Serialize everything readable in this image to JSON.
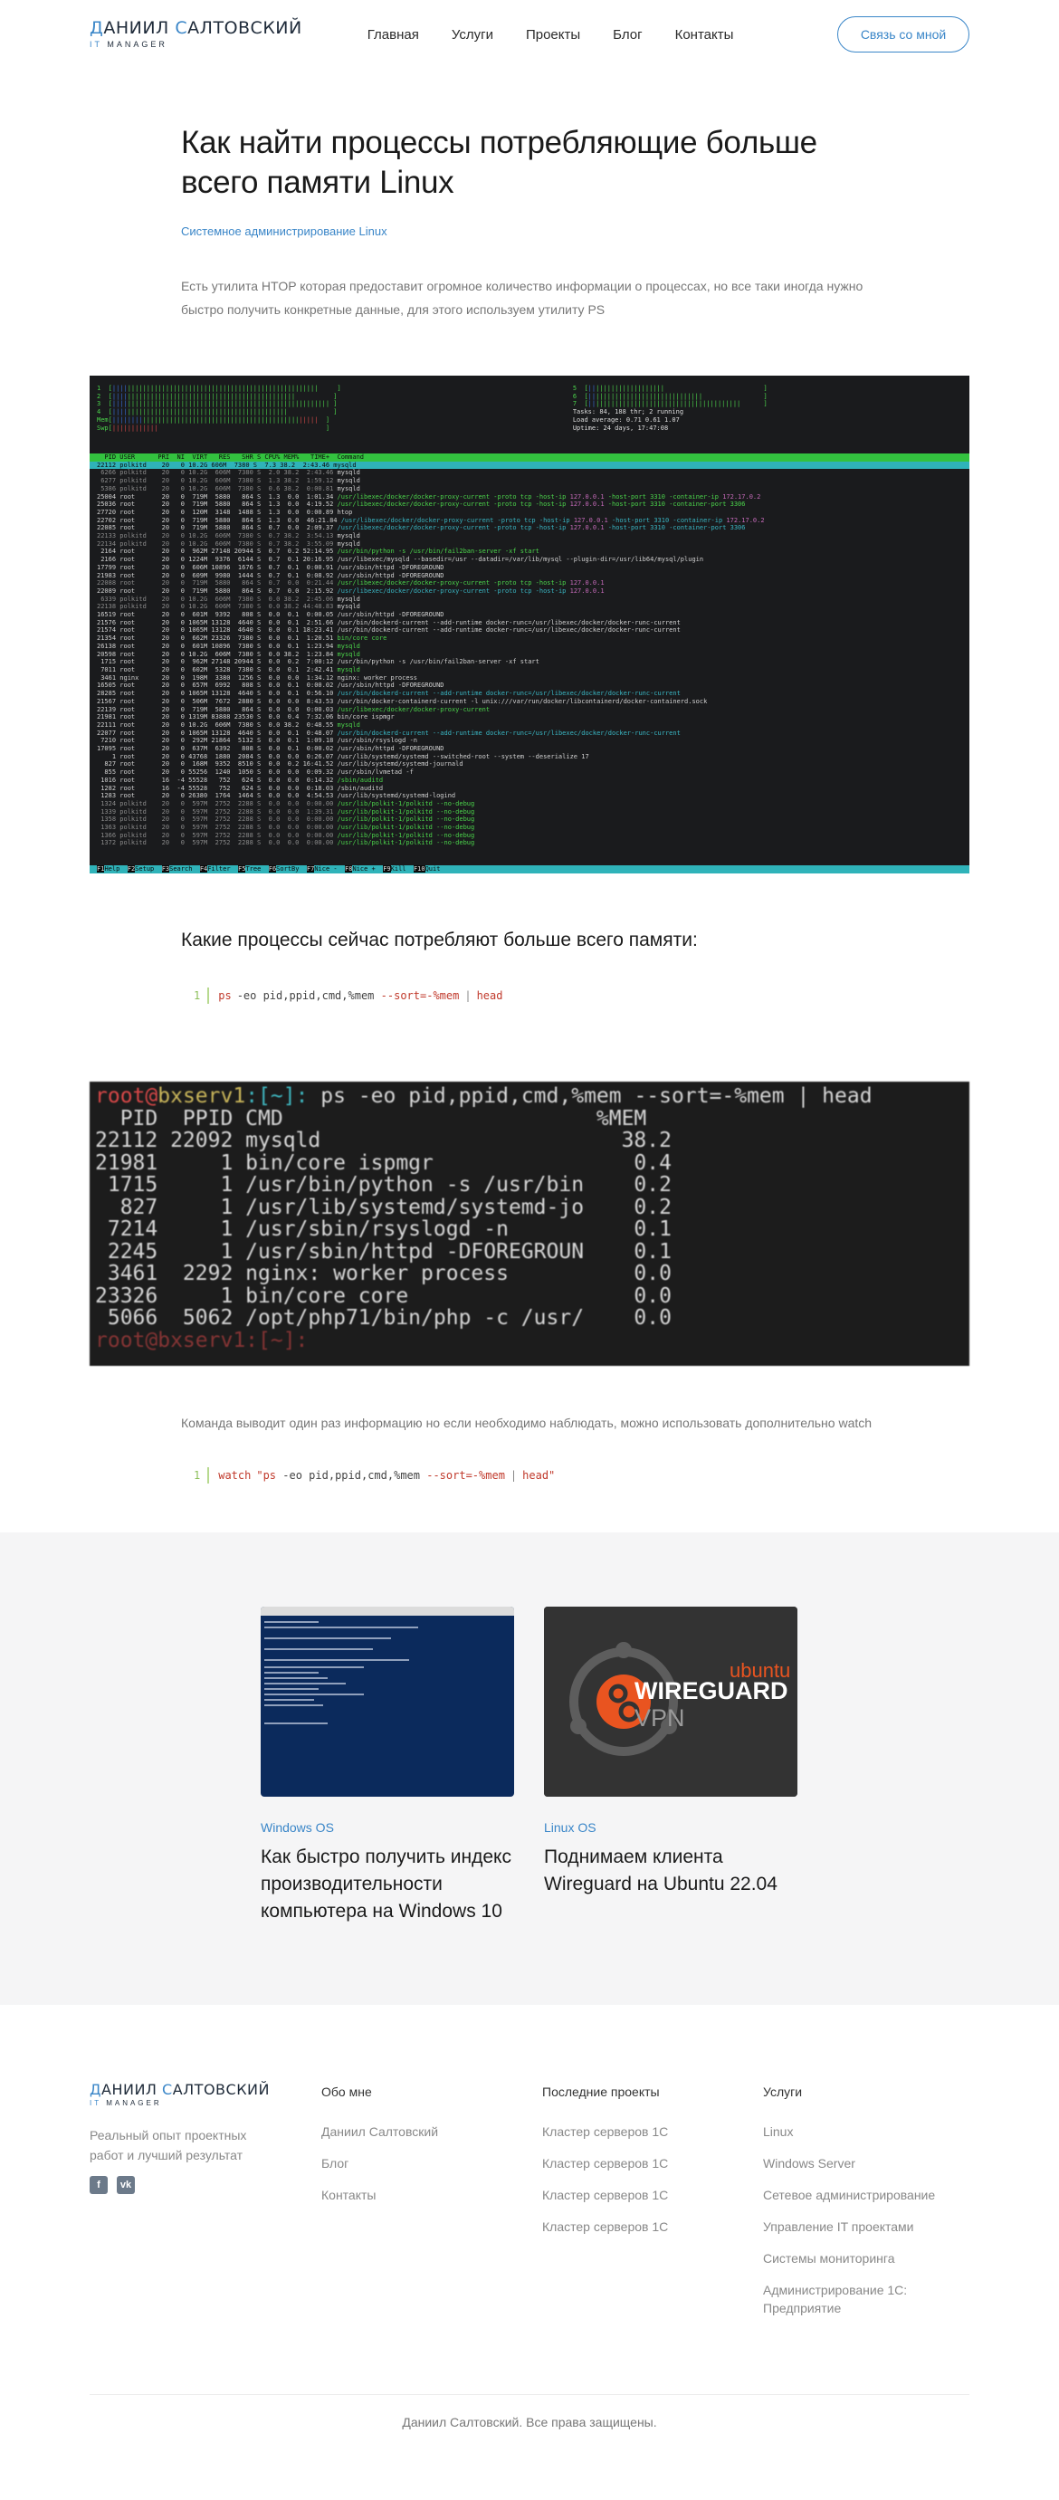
{
  "header": {
    "logo_first": "Д",
    "logo_first_rest": "АНИИЛ ",
    "logo_last": "С",
    "logo_last_rest": "АЛТОВСКИЙ",
    "logo_sub_it": "IT ",
    "logo_sub_manager": "MANAGER",
    "nav": [
      "Главная",
      "Услуги",
      "Проекты",
      "Блог",
      "Контакты"
    ],
    "contact_button": "Связь со мной"
  },
  "article": {
    "title": "Как найти процессы потребляющие больше всего памяти Linux",
    "category": "Системное администрирование Linux",
    "intro": "Есть утилита HTOP которая предоставит огромное количество информации о процессах, но все таки иногда нужно быстро получить конкретные данные, для этого используем утилиту PS",
    "section_heading": "Какие процессы сейчас потребляют больше всего памяти:",
    "code1": {
      "line": "1",
      "cmd": "ps",
      "args": "-eo pid,ppid,cmd,%mem ",
      "opt": "--sort=-%mem",
      "pipe": "|",
      "tail": "head"
    },
    "note": "Команда выводит один раз информацию но если необходимо наблюдать, можно использовать дополнительно watch",
    "code2": {
      "line": "1",
      "cmd": "watch",
      "quote1": "\"ps",
      "args": " -eo pid,ppid,cmd,%mem ",
      "opt": "--sort=-%mem",
      "pipe": "|",
      "tail": "head\""
    }
  },
  "htop": {
    "summary": [
      "Tasks: 84, 188 thr; 2 running",
      "Load average: 0.71 0.61 1.07",
      "Uptime: 24 days, 17:47:08"
    ],
    "header": "  PID USER      PRI  NI  VIRT   RES   SHR S CPU% MEM%   TIME+  Command",
    "selected": "22112 polkitd    20   0 10.2G 606M  7380 S  7.3 38.2  2:43.46 mysqld",
    "footer_keys": [
      [
        "F1",
        "Help"
      ],
      [
        "F2",
        "Setup"
      ],
      [
        "F3",
        "Search"
      ],
      [
        "F4",
        "Filter"
      ],
      [
        "F5",
        "Tree"
      ],
      [
        "F6",
        "SortBy"
      ],
      [
        "F7",
        "Nice -"
      ],
      [
        "F8",
        "Nice +"
      ],
      [
        "F9",
        "Kill"
      ],
      [
        "F10",
        "Quit"
      ]
    ]
  },
  "ps_terminal": {
    "prompt_user": "root@",
    "prompt_host": "bxserv1",
    "prompt_path": ":[~]:",
    "command": " ps -eo pid,ppid,cmd,%mem --sort=-%mem | head",
    "header": "  PID  PPID CMD                         %MEM",
    "rows": [
      [
        "22112",
        "22092",
        "mysqld",
        "38.2"
      ],
      [
        "21981",
        "1",
        "bin/core ispmgr",
        "0.4"
      ],
      [
        "1715",
        "1",
        "/usr/bin/python -s /usr/bin",
        "0.2"
      ],
      [
        "827",
        "1",
        "/usr/lib/systemd/systemd-jo",
        "0.2"
      ],
      [
        "7214",
        "1",
        "/usr/sbin/rsyslogd -n",
        "0.1"
      ],
      [
        "2245",
        "1",
        "/usr/sbin/httpd -DFOREGROUN",
        "0.1"
      ],
      [
        "3461",
        "2292",
        "nginx: worker process",
        "0.0"
      ],
      [
        "23326",
        "1",
        "bin/core core",
        "0.0"
      ],
      [
        "5066",
        "5062",
        "/opt/php71/bin/php -c /usr/",
        "0.0"
      ]
    ],
    "last_prompt": "root@bxserv1:[~]: "
  },
  "related": [
    {
      "category": "Windows OS",
      "title": "Как быстро получить индекс производительности компьютера на Windows 10"
    },
    {
      "category": "Linux OS",
      "title": "Поднимаем клиента Wireguard на Ubuntu 22.04",
      "img_brand": "ubuntu",
      "img_name": "WIREGUARD",
      "img_sub": "VPN"
    }
  ],
  "footer": {
    "tagline": "Реальный опыт проектных работ и лучший результат",
    "social": [
      "f",
      "vk"
    ],
    "about": {
      "heading": "Обо мне",
      "links": [
        "Даниил Салтовский",
        "Блог",
        "Контакты"
      ]
    },
    "projects": {
      "heading": "Последние проекты",
      "links": [
        "Кластер серверов 1С",
        "Кластер серверов 1С",
        "Кластер серверов 1С",
        "Кластер серверов 1С"
      ]
    },
    "services": {
      "heading": "Услуги",
      "links": [
        "Linux",
        "Windows Server",
        "Сетевое администрирование",
        "Управление IT проектами",
        "Системы мониторинга",
        "Администрирование 1С: Предприятие"
      ]
    },
    "copyright": "Даниил Салтовский. Все права защищены."
  },
  "colors": {
    "accent": "#3a86c8",
    "htop_green": "#33c23f",
    "htop_cyan": "#2fb3b9"
  }
}
